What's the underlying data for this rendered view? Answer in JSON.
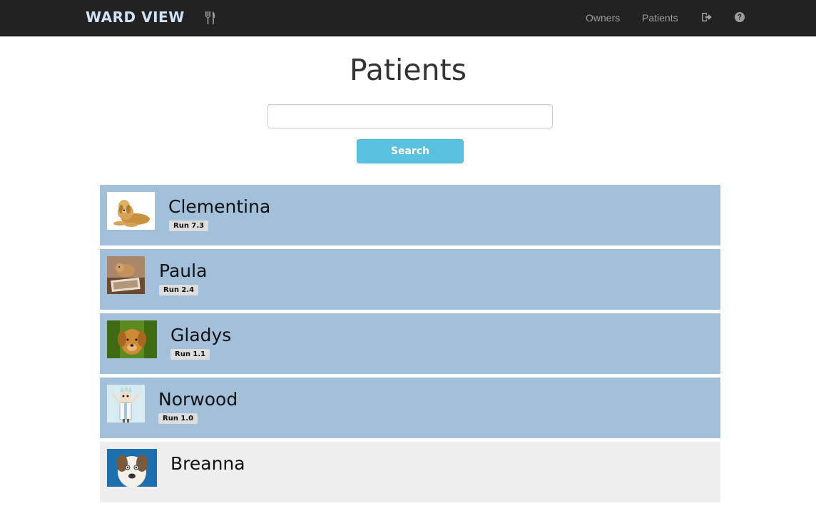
{
  "navbar": {
    "brand": "WARD VIEW",
    "links": [
      {
        "label": "Owners"
      },
      {
        "label": "Patients"
      }
    ],
    "icons": [
      "utensils-icon",
      "logout-icon",
      "help-circle-icon"
    ]
  },
  "main": {
    "title": "Patients",
    "search": {
      "value": "",
      "placeholder": "",
      "button_label": "Search"
    },
    "patients": [
      {
        "name": "Clementina",
        "run": "Run 7.3",
        "image": "golden-retriever-lying-photo"
      },
      {
        "name": "Paula",
        "run": "Run 2.4",
        "image": "dog-on-bed-photo"
      },
      {
        "name": "Gladys",
        "run": "Run 1.1",
        "image": "golden-puppy-photo"
      },
      {
        "name": "Norwood",
        "run": "Run 1.0",
        "image": "cartoon-scientist-photo"
      },
      {
        "name": "Breanna",
        "run": "",
        "image": "white-dog-closeup-photo"
      }
    ]
  },
  "colors": {
    "navbar_bg": "#222222",
    "brand": "#cfe2f3",
    "row_highlight": "#a3c0db",
    "row_plain": "#eeeeee",
    "search_button": "#5bc0de"
  }
}
